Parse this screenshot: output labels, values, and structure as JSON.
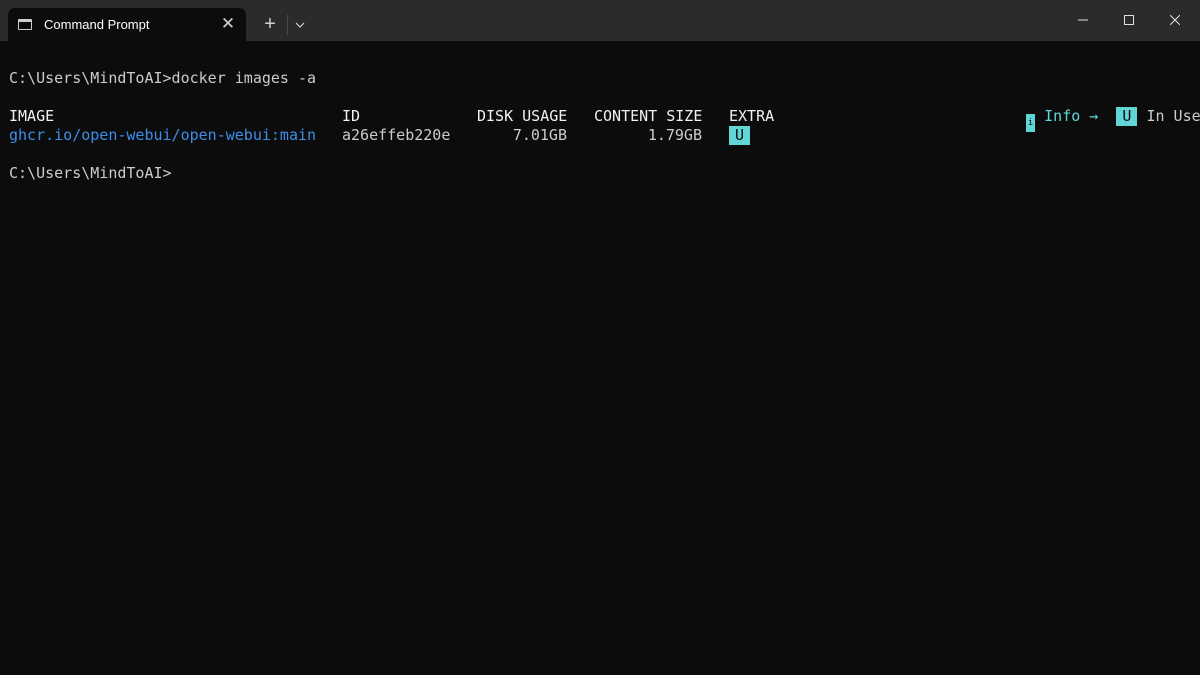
{
  "window": {
    "tab_title": "Command Prompt",
    "tab_close_glyph": "✕",
    "new_tab_glyph": "+"
  },
  "terminal": {
    "command_line": "C:\\Users\\MindToAI>docker images -a",
    "prompt_line": "C:\\Users\\MindToAI>",
    "table": {
      "headers": [
        "IMAGE",
        "ID",
        "DISK USAGE",
        "CONTENT SIZE",
        "EXTRA"
      ],
      "rows": [
        {
          "image": "ghcr.io/open-webui/open-webui:main",
          "id": "a26effeb220e",
          "disk_usage": "7.01GB",
          "content_size": "1.79GB",
          "extra": "U"
        }
      ]
    },
    "legend": {
      "info_marker": "i",
      "info_label": "Info →",
      "in_use_badge": "U",
      "in_use_label": "In Use"
    }
  },
  "colors": {
    "background": "#0c0c0c",
    "titlebar": "#2b2b2b",
    "text": "#cccccc",
    "link": "#3b8eea",
    "accent": "#61d6d6"
  }
}
